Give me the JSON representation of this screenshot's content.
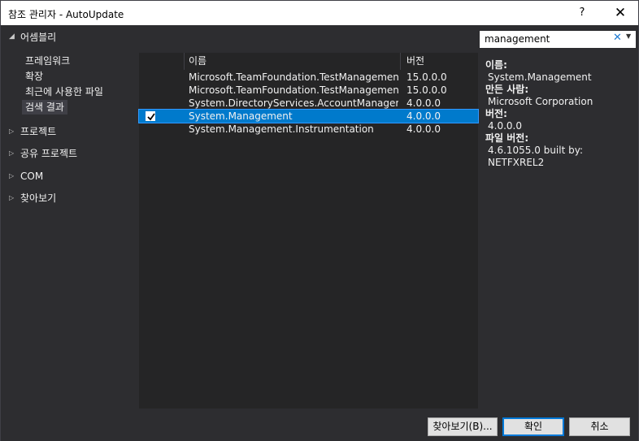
{
  "window": {
    "title": "참조 관리자 - AutoUpdate",
    "help_label": "?",
    "close_label": "✕"
  },
  "sidebar": {
    "assemblies": {
      "label": "어셈블리",
      "expanded_arrow": "◢",
      "items": [
        {
          "label": "프레임워크"
        },
        {
          "label": "확장"
        },
        {
          "label": "최근에 사용한 파일"
        },
        {
          "label": "검색 결과",
          "selected": true
        }
      ]
    },
    "collapsed_arrow": "▷",
    "categories": [
      {
        "label": "프로젝트"
      },
      {
        "label": "공유 프로젝트"
      },
      {
        "label": "COM"
      },
      {
        "label": "찾아보기"
      }
    ]
  },
  "list": {
    "headers": {
      "name": "이름",
      "version": "버전"
    },
    "rows": [
      {
        "name": "Microsoft.TeamFoundation.TestManagement....",
        "version": "15.0.0.0",
        "checked": false,
        "selected": false
      },
      {
        "name": "Microsoft.TeamFoundation.TestManagement....",
        "version": "15.0.0.0",
        "checked": false,
        "selected": false
      },
      {
        "name": "System.DirectoryServices.AccountManagement",
        "version": "4.0.0.0",
        "checked": false,
        "selected": false
      },
      {
        "name": "System.Management",
        "version": "4.0.0.0",
        "checked": true,
        "selected": true
      },
      {
        "name": "System.Management.Instrumentation",
        "version": "4.0.0.0",
        "checked": false,
        "selected": false
      }
    ]
  },
  "search": {
    "value": "management",
    "clear_icon": "✕",
    "dropdown_icon": "▼"
  },
  "details": {
    "name_label": "이름:",
    "name_value": "System.Management",
    "author_label": "만든 사람:",
    "author_value": "Microsoft Corporation",
    "version_label": "버전:",
    "version_value": "4.0.0.0",
    "file_version_label": "파일 버전:",
    "file_version_value": "4.6.1055.0 built by: NETFXREL2"
  },
  "footer": {
    "browse_label": "찾아보기(B)...",
    "ok_label": "확인",
    "cancel_label": "취소"
  },
  "colors": {
    "background": "#2d2d30",
    "list_background": "#252526",
    "selection": "#007acc",
    "search_clear": "#1e7bd3"
  }
}
